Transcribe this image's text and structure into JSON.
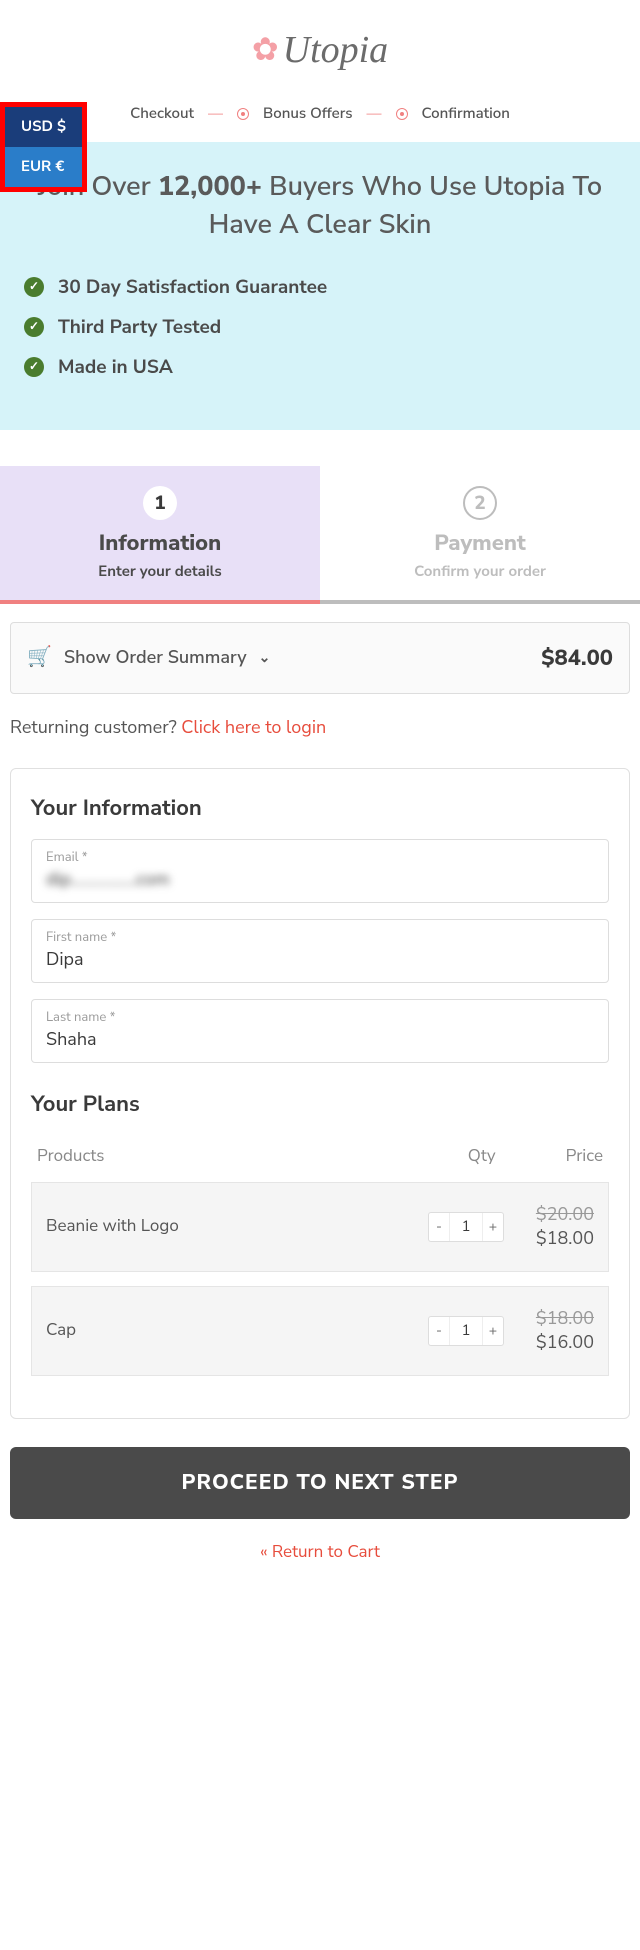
{
  "logo": {
    "text": "Utopia"
  },
  "currency": {
    "options": [
      "USD $",
      "EUR €"
    ]
  },
  "breadcrumb": {
    "a": "Checkout",
    "b": "Bonus Offers",
    "c": "Confirmation"
  },
  "hero": {
    "pre": "Join Over ",
    "bold": "12,000+",
    "post": " Buyers Who Use Utopia To Have A Clear Skin",
    "checks": [
      "30 Day Satisfaction Guarantee",
      "Third Party Tested",
      "Made in USA"
    ]
  },
  "steps": {
    "s1": {
      "num": "1",
      "title": "Information",
      "sub": "Enter your details"
    },
    "s2": {
      "num": "2",
      "title": "Payment",
      "sub": "Confirm your order"
    }
  },
  "summary": {
    "label": "Show Order Summary",
    "total": "$84.00"
  },
  "returning": {
    "text": "Returning customer? ",
    "link": "Click here to login"
  },
  "info": {
    "title": "Your Information",
    "email": {
      "label": "Email *",
      "value": "dip................com"
    },
    "first": {
      "label": "First name *",
      "value": "Dipa"
    },
    "last": {
      "label": "Last name *",
      "value": "Shaha"
    }
  },
  "plans": {
    "title": "Your Plans",
    "headers": {
      "products": "Products",
      "qty": "Qty",
      "price": "Price"
    },
    "rows": [
      {
        "name": "Beanie with Logo",
        "qty": "1",
        "old": "$20.00",
        "new": "$18.00"
      },
      {
        "name": "Cap",
        "qty": "1",
        "old": "$18.00",
        "new": "$16.00"
      }
    ]
  },
  "proceed": "PROCEED TO NEXT STEP",
  "return_link": "« Return to Cart"
}
